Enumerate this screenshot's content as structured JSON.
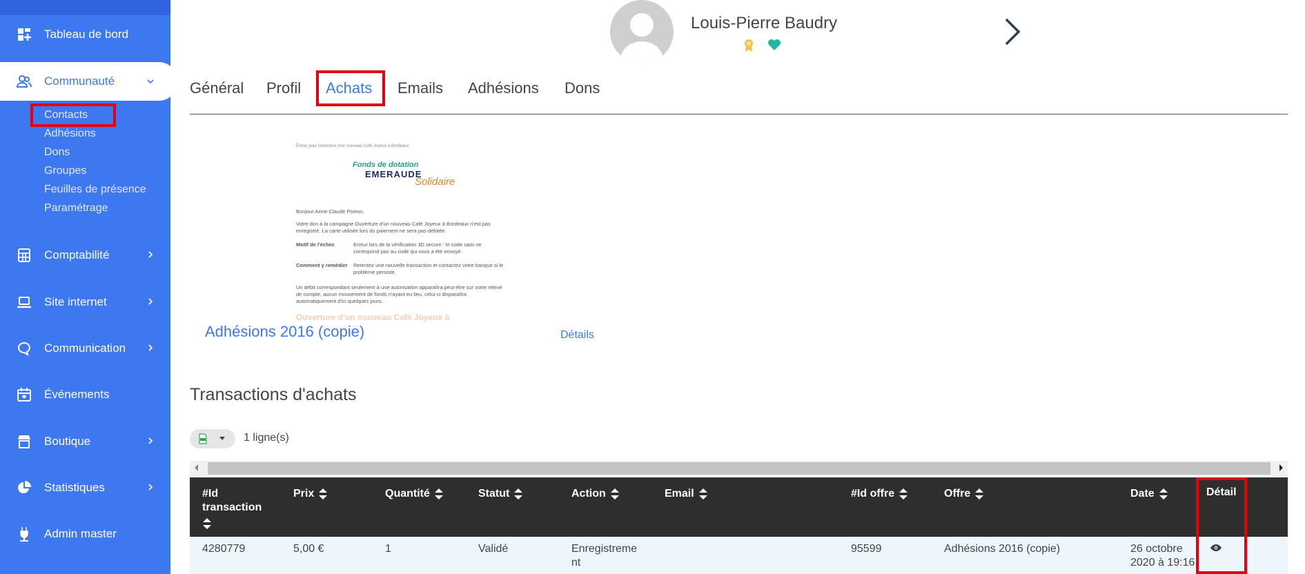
{
  "sidebar": {
    "items": [
      {
        "label": "Tableau de bord"
      },
      {
        "label": "Communauté"
      },
      {
        "label": "Comptabilité"
      },
      {
        "label": "Site internet"
      },
      {
        "label": "Communication"
      },
      {
        "label": "Événements"
      },
      {
        "label": "Boutique"
      },
      {
        "label": "Statistiques"
      },
      {
        "label": "Admin master"
      }
    ],
    "subitems": [
      "Contacts",
      "Adhésions",
      "Dons",
      "Groupes",
      "Feuilles de présence",
      "Paramétrage"
    ]
  },
  "header": {
    "user_name": "Louis-Pierre Baudry"
  },
  "tabs": [
    "Général",
    "Profil",
    "Achats",
    "Emails",
    "Adhésions",
    "Dons"
  ],
  "active_tab": "Achats",
  "receipt": {
    "header_line": "Échec pour Ouverture d'un nouveau Café Joyeux à Bordeaux",
    "logo_line1": "Fonds de dotation",
    "logo_line2": "EMERAUDE",
    "logo_line3": "Solidaire",
    "greeting": "Bonjour Anne-Claude Poinso,",
    "intro": "Votre don à la campagne Ouverture d'un nouveau Café Joyeux à Bordeaux n'est pas enregistré. La carte utilisée lors du paiement ne sera pas débitée.",
    "reason_label": "Motif de l'échec",
    "reason_text": "Erreur lors de la vérification 3D secure : le code saisi ne correspond pas au code qui vous a été envoyé.",
    "fix_label": "Comment y remédier",
    "fix_text": "Retentez une nouvelle transaction et contactez votre banque si le problème persiste.",
    "note": "Un débit correspondant seulement à une autorisation apparaîtra peut-être sur votre relevé de compte, aucun mouvement de fonds n'ayant eu lieu, celui-ci disparaîtra automatiquement d'ici quelques jours.",
    "faded_title": "Ouverture d'un nouveau Café Joyeux à"
  },
  "offer": {
    "title": "Adhésions 2016 (copie)",
    "details_link": "Détails"
  },
  "transactions": {
    "title": "Transactions d'achats",
    "row_count": "1 ligne(s)",
    "columns": [
      "#Id transaction",
      "Prix",
      "Quantité",
      "Statut",
      "Action",
      "Email",
      "#Id offre",
      "Offre",
      "Date",
      "Détail"
    ],
    "rows": [
      {
        "id": "4280779",
        "prix": "5,00 €",
        "quantite": "1",
        "statut": "Validé",
        "action": "Enregistrement",
        "email": "",
        "id_offre": "95599",
        "offre": "Adhésions 2016 (copie)",
        "date": "26 octobre 2020 à 19:16"
      }
    ]
  },
  "colors": {
    "sidebar": "#3e78f0",
    "accent": "#3e78f0",
    "highlight": "#e3000f",
    "table_header": "#2e2e2e"
  }
}
